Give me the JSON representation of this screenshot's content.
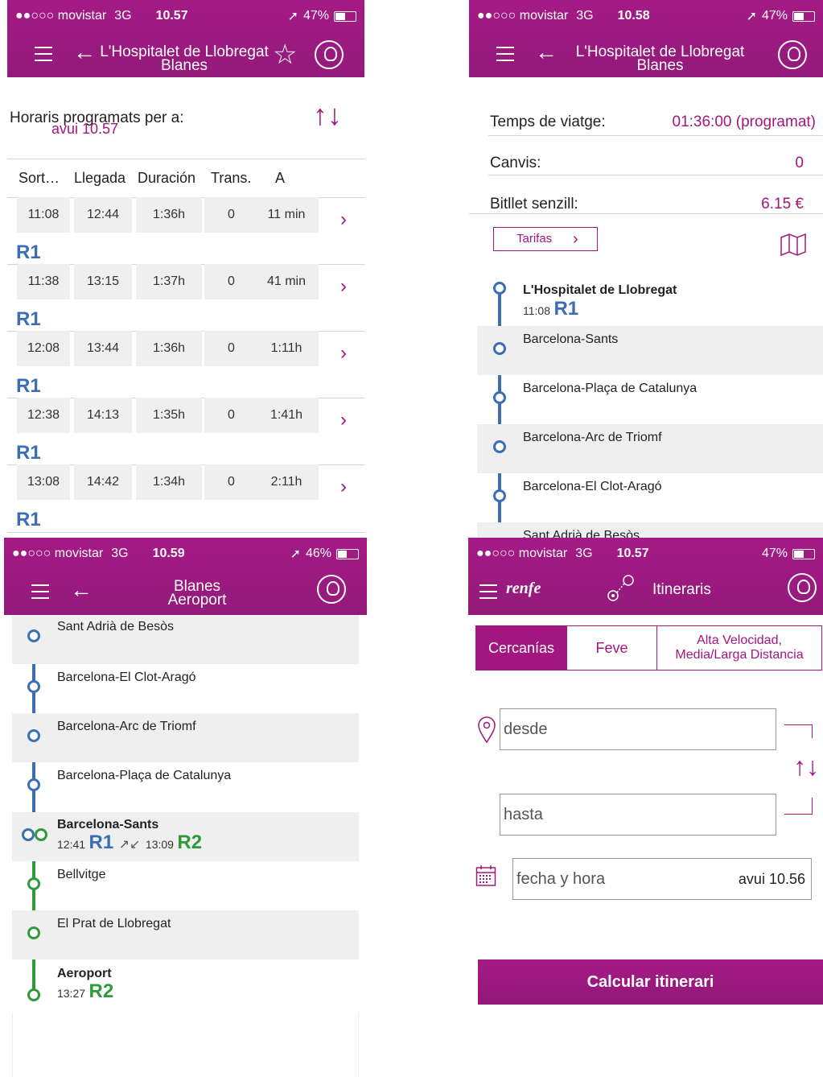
{
  "colors": {
    "brand": "#a3167f",
    "r1": "#3c6eb4",
    "r2": "#2e9a3c"
  },
  "status": [
    {
      "carrier": "●●○○○ movistar",
      "net": "3G",
      "time": "10.57",
      "battery": "47%"
    },
    {
      "carrier": "●●○○○ movistar",
      "net": "3G",
      "time": "10.58",
      "battery": "47%"
    },
    {
      "carrier": "●●○○○ movistar",
      "net": "3G",
      "time": "10.59",
      "battery": "46%"
    },
    {
      "carrier": "●●○○○ movistar",
      "net": "3G",
      "time": "10.57",
      "battery": "47%"
    }
  ],
  "p1": {
    "title1": "L'Hospitalet de Llobregat",
    "title2": "Blanes",
    "schedule_label": "Horaris programats per a:",
    "schedule_date": "avui 10.57",
    "cols": [
      "Sort…",
      "Llegada",
      "Duración",
      "Trans.",
      "A"
    ],
    "rows": [
      {
        "dep": "11:08",
        "arr": "12:44",
        "dur": "1:36h",
        "trans": "0",
        "in": "11 min",
        "line": "R1"
      },
      {
        "dep": "11:38",
        "arr": "13:15",
        "dur": "1:37h",
        "trans": "0",
        "in": "41 min",
        "line": "R1"
      },
      {
        "dep": "12:08",
        "arr": "13:44",
        "dur": "1:36h",
        "trans": "0",
        "in": "1:11h",
        "line": "R1"
      },
      {
        "dep": "12:38",
        "arr": "14:13",
        "dur": "1:35h",
        "trans": "0",
        "in": "1:41h",
        "line": "R1"
      },
      {
        "dep": "13:08",
        "arr": "14:42",
        "dur": "1:34h",
        "trans": "0",
        "in": "2:11h",
        "line": "R1"
      }
    ]
  },
  "p2": {
    "title1": "L'Hospitalet de Llobregat",
    "title2": "Blanes",
    "travel_label": "Temps de viatge:",
    "travel_value": "01:36:00 (programat)",
    "changes_label": "Canvis:",
    "changes_value": "0",
    "ticket_label": "Bitllet senzill:",
    "ticket_value": "6.15 €",
    "tariffs_button": "Tarifas",
    "origin": "L'Hospitalet de Llobregat",
    "origin_time": "11:08",
    "origin_line": "R1",
    "stops": [
      "Barcelona-Sants",
      "Barcelona-Plaça de Catalunya",
      "Barcelona-Arc de Triomf",
      "Barcelona-El Clot-Aragó",
      "Sant Adrià de Besòs"
    ]
  },
  "p3": {
    "title1": "Blanes",
    "title2": "Aeroport",
    "stops_r1": [
      "Sant Adrià de Besòs",
      "Barcelona-El Clot-Aragó",
      "Barcelona-Arc de Triomf",
      "Barcelona-Plaça de Catalunya"
    ],
    "transfer": {
      "name": "Barcelona-Sants",
      "arr": "12:41",
      "arr_line": "R1",
      "dep": "13:09",
      "dep_line": "R2"
    },
    "stops_r2": [
      "Bellvitge",
      "El Prat de Llobregat"
    ],
    "dest": {
      "name": "Aeroport",
      "time": "13:27",
      "line": "R2"
    }
  },
  "p4": {
    "logo": "renfe",
    "title": "Itineraris",
    "tabs": [
      "Cercanías",
      "Feve",
      "Alta Velocidad,\nMedia/Larga Distancia"
    ],
    "from_placeholder": "desde",
    "to_placeholder": "hasta",
    "date_placeholder": "fecha y hora",
    "date_value": "avui 10.56",
    "calc_button": "Calcular itinerari"
  }
}
